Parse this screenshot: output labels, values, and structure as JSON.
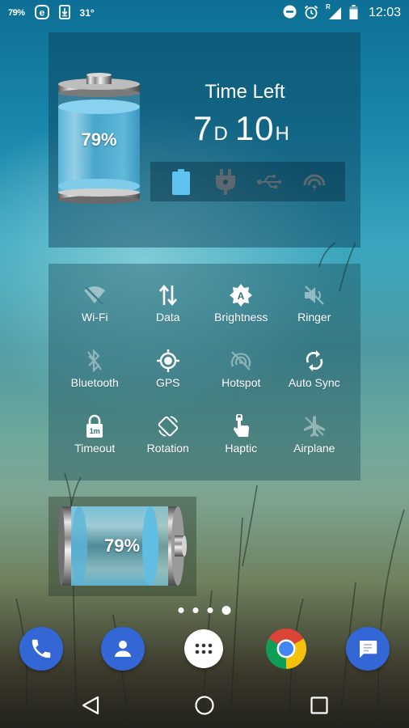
{
  "status_bar": {
    "battery_percent": "79%",
    "left_icons": [
      "e-app-icon",
      "download-icon"
    ],
    "temperature": "31°",
    "right_icons": [
      "do-not-disturb-icon",
      "alarm-icon",
      "roaming-signal-icon",
      "battery-icon"
    ],
    "roaming_indicator": "R",
    "time": "12:03"
  },
  "battery_widget": {
    "level_percent": 79,
    "level_label": "79%",
    "time_left_title": "Time Left",
    "time_left": {
      "days": "7",
      "days_unit": "D",
      "hours": "10",
      "hours_unit": "H"
    },
    "power_sources": [
      {
        "name": "battery",
        "active": true,
        "color": "#5fc3ef"
      },
      {
        "name": "ac-plug",
        "active": false,
        "color": "#5d6770"
      },
      {
        "name": "usb",
        "active": false,
        "color": "#5d6770"
      },
      {
        "name": "wireless",
        "active": false,
        "color": "#5d6770"
      }
    ]
  },
  "toggles_widget": {
    "toggles": [
      {
        "label": "Wi-Fi",
        "icon": "wifi-off-icon",
        "enabled": false
      },
      {
        "label": "Data",
        "icon": "data-arrows-icon",
        "enabled": true
      },
      {
        "label": "Brightness",
        "icon": "brightness-auto-icon",
        "enabled": true
      },
      {
        "label": "Ringer",
        "icon": "ringer-mute-icon",
        "enabled": false
      },
      {
        "label": "Bluetooth",
        "icon": "bluetooth-off-icon",
        "enabled": false
      },
      {
        "label": "GPS",
        "icon": "gps-icon",
        "enabled": true
      },
      {
        "label": "Hotspot",
        "icon": "hotspot-off-icon",
        "enabled": false
      },
      {
        "label": "Auto Sync",
        "icon": "sync-icon",
        "enabled": true
      },
      {
        "label": "Timeout",
        "icon": "timeout-lock-icon",
        "enabled": true,
        "badge": "1m"
      },
      {
        "label": "Rotation",
        "icon": "rotation-icon",
        "enabled": true
      },
      {
        "label": "Haptic",
        "icon": "haptic-touch-icon",
        "enabled": true
      },
      {
        "label": "Airplane",
        "icon": "airplane-off-icon",
        "enabled": false
      }
    ]
  },
  "small_battery_widget": {
    "level_percent": 79,
    "level_label": "79%"
  },
  "home_pages": {
    "count": 4,
    "current": 4
  },
  "dock": {
    "apps": [
      {
        "name": "Phone",
        "color": "#3367d6"
      },
      {
        "name": "Contacts",
        "color": "#3367d6"
      },
      {
        "name": "All apps",
        "color": "#ffffff"
      },
      {
        "name": "Chrome",
        "color": "#4285f4"
      },
      {
        "name": "Messages",
        "color": "#3367d6"
      }
    ]
  },
  "nav_bar": {
    "buttons": [
      "back",
      "home",
      "recents"
    ]
  }
}
